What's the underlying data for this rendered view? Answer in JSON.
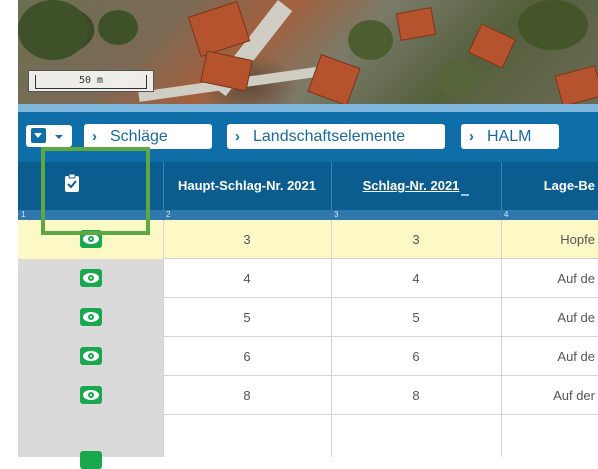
{
  "map": {
    "scale_label": "50 m"
  },
  "toolbar": {
    "tabs": [
      "Schläge",
      "Landschaftselemente",
      "HALM"
    ]
  },
  "table": {
    "columns": [
      "",
      "Haupt-Schlag-Nr. 2021",
      "Schlag-Nr. 2021",
      "Lage-Be"
    ],
    "column_numbers": [
      "1",
      "2",
      "3",
      "4"
    ],
    "sorted_column": "Schlag-Nr. 2021",
    "rows": [
      {
        "haupt": "3",
        "schlag": "3",
        "lage": "Hopfe",
        "highlighted": true
      },
      {
        "haupt": "4",
        "schlag": "4",
        "lage": "Auf de",
        "highlighted": false
      },
      {
        "haupt": "5",
        "schlag": "5",
        "lage": "Auf de",
        "highlighted": false
      },
      {
        "haupt": "6",
        "schlag": "6",
        "lage": "Auf de",
        "highlighted": false
      },
      {
        "haupt": "8",
        "schlag": "8",
        "lage": "Auf der",
        "highlighted": false
      }
    ]
  },
  "icons": {
    "header_icon": "clipboard-check-icon",
    "row_icon": "eye-icon",
    "menu_icon": "dropdown-menu-icon",
    "tab_icon": "chevron-right-icon"
  },
  "colors": {
    "toolbar": "#0f6ea8",
    "header": "#0b5d8f",
    "highlight_row": "#fdf9c6",
    "eye_green": "#19a84e",
    "annotation_box": "#5ea843"
  }
}
